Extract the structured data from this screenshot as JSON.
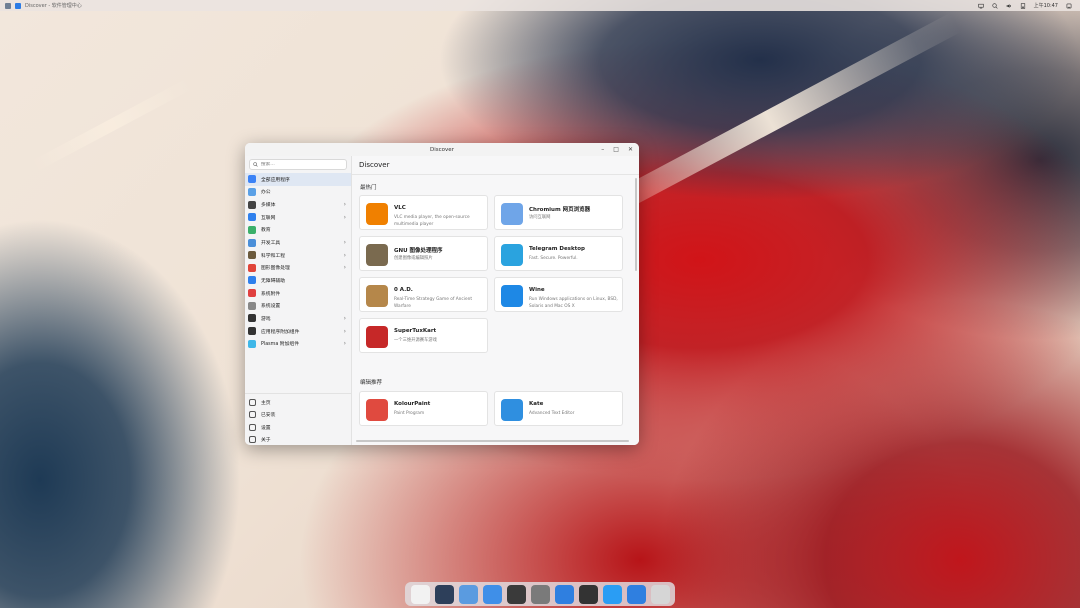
{
  "top_panel": {
    "window_title": "Discover - 软件管理中心",
    "clock": "上午10:47"
  },
  "window": {
    "title": "Discover",
    "controls": [
      "minimize",
      "maximize",
      "close"
    ]
  },
  "sidebar": {
    "search_placeholder": "搜索…",
    "categories": [
      {
        "label": "全部应用程序",
        "icon": "all-apps-icon",
        "color": "#3b82f6",
        "has_submenu": false
      },
      {
        "label": "办公",
        "icon": "office-icon",
        "color": "#5aa0e6",
        "has_submenu": false
      },
      {
        "label": "多媒体",
        "icon": "multimedia-icon",
        "color": "#444444",
        "has_submenu": true
      },
      {
        "label": "互联网",
        "icon": "internet-icon",
        "color": "#2f80ed",
        "has_submenu": true
      },
      {
        "label": "教育",
        "icon": "education-icon",
        "color": "#3bb06a",
        "has_submenu": false
      },
      {
        "label": "开发工具",
        "icon": "dev-tools-icon",
        "color": "#4a8fd9",
        "has_submenu": true
      },
      {
        "label": "科学和工程",
        "icon": "science-icon",
        "color": "#6b5a3d",
        "has_submenu": true
      },
      {
        "label": "图形图像处理",
        "icon": "graphics-icon",
        "color": "#e0453a",
        "has_submenu": true
      },
      {
        "label": "无障碍辅助",
        "icon": "accessibility-icon",
        "color": "#2f80ed",
        "has_submenu": false
      },
      {
        "label": "系统附件",
        "icon": "utilities-icon",
        "color": "#e04040",
        "has_submenu": false
      },
      {
        "label": "系统设置",
        "icon": "settings-icon",
        "color": "#888888",
        "has_submenu": false
      },
      {
        "label": "游戏",
        "icon": "games-icon",
        "color": "#333333",
        "has_submenu": true
      },
      {
        "label": "应用程序附加组件",
        "icon": "addons-icon",
        "color": "#333333",
        "has_submenu": true
      },
      {
        "label": "Plasma 附加组件",
        "icon": "plasma-icon",
        "color": "#3fb7e8",
        "has_submenu": true
      }
    ],
    "bottom": [
      {
        "label": "主页",
        "icon": "home-icon"
      },
      {
        "label": "已安装",
        "icon": "installed-icon"
      },
      {
        "label": "设置",
        "icon": "settings-gear-icon"
      },
      {
        "label": "关于",
        "icon": "about-icon"
      },
      {
        "label": "更新(U) (131)",
        "icon": "updates-icon",
        "badge": "!"
      }
    ]
  },
  "main": {
    "header": "Discover",
    "popular_title": "最热门",
    "popular": [
      {
        "name": "VLC",
        "desc": "VLC media player, the open-source multimedia player",
        "icon": "vlc-icon",
        "color": "#f08000"
      },
      {
        "name": "Chromium 网页浏览器",
        "desc": "访问互联网",
        "icon": "chromium-icon",
        "color": "#6fa5e8"
      },
      {
        "name": "GNU 图像处理程序",
        "desc": "创建图像或编辑照片",
        "icon": "gimp-icon",
        "color": "#7a6a4f"
      },
      {
        "name": "Telegram Desktop",
        "desc": "Fast. Secure. Powerful.",
        "icon": "telegram-icon",
        "color": "#2aa3df"
      },
      {
        "name": "0 A.D.",
        "desc": "Real-Time Strategy Game of Ancient Warfare",
        "icon": "0ad-icon",
        "color": "#b5874a"
      },
      {
        "name": "Wine",
        "desc": "Run Windows applications on Linux, BSD, Solaris and Mac OS X",
        "icon": "wine-icon",
        "color": "#1e88e5"
      },
      {
        "name": "SuperTuxKart",
        "desc": "一个三维开源赛车游戏",
        "icon": "supertuxkart-icon",
        "color": "#c62828"
      }
    ],
    "editor_title": "编辑推荐",
    "editor": [
      {
        "name": "KolourPaint",
        "desc": "Paint Program",
        "icon": "kolourpaint-icon",
        "color": "#e04a3f"
      },
      {
        "name": "Kate",
        "desc": "Advanced Text Editor",
        "icon": "kate-icon",
        "color": "#2f8fe0"
      }
    ]
  },
  "dock": {
    "items": [
      {
        "icon": "launcher-icon",
        "color": "#f2f2f2"
      },
      {
        "icon": "multitask-icon",
        "color": "#2d3f5a"
      },
      {
        "icon": "browser-icon",
        "color": "#5a9be0"
      },
      {
        "icon": "files-icon",
        "color": "#3f8fe8"
      },
      {
        "icon": "terminal-icon",
        "color": "#3a3a3a"
      },
      {
        "icon": "settings-app-icon",
        "color": "#7a7a7a"
      },
      {
        "icon": "store-icon",
        "color": "#2f7fe0"
      },
      {
        "icon": "screenshot-icon",
        "color": "#333333"
      },
      {
        "icon": "finder-icon",
        "color": "#2a9df4"
      },
      {
        "icon": "download-icon",
        "color": "#2f7fe0"
      },
      {
        "icon": "trash-icon",
        "color": "#d6d6d6"
      }
    ]
  }
}
